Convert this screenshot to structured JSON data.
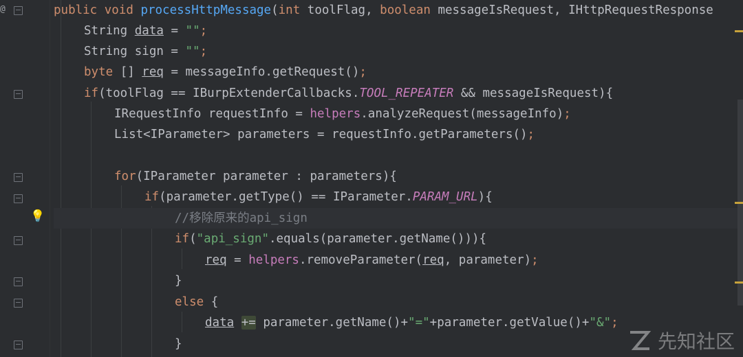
{
  "editor": {
    "lines": [
      {
        "id": "l1",
        "tokens": [
          {
            "t": "public void ",
            "c": "kw"
          },
          {
            "t": "processHttpMessage",
            "c": "fn"
          },
          {
            "t": "(",
            "c": ""
          },
          {
            "t": "int ",
            "c": "kw"
          },
          {
            "t": "toolFlag, ",
            "c": ""
          },
          {
            "t": "boolean ",
            "c": "kw"
          },
          {
            "t": "messageIsRequest, IHttpRequestResponse",
            "c": ""
          }
        ]
      },
      {
        "id": "l2",
        "tokens": [
          {
            "t": "String ",
            "c": ""
          },
          {
            "t": "data",
            "c": "under"
          },
          {
            "t": " = ",
            "c": ""
          },
          {
            "t": "\"\"",
            "c": "str"
          },
          {
            "t": ";",
            "c": "kw"
          }
        ]
      },
      {
        "id": "l3",
        "tokens": [
          {
            "t": "String sign = ",
            "c": ""
          },
          {
            "t": "\"\"",
            "c": "str"
          },
          {
            "t": ";",
            "c": "kw"
          }
        ]
      },
      {
        "id": "l4",
        "tokens": [
          {
            "t": "byte ",
            "c": "kw"
          },
          {
            "t": "[] ",
            "c": ""
          },
          {
            "t": "req",
            "c": "under"
          },
          {
            "t": " = messageInfo.getRequest()",
            "c": ""
          },
          {
            "t": ";",
            "c": "kw"
          }
        ]
      },
      {
        "id": "l5",
        "tokens": [
          {
            "t": "if",
            "c": "kw"
          },
          {
            "t": "(toolFlag == IBurpExtenderCallbacks.",
            "c": ""
          },
          {
            "t": "TOOL_REPEATER",
            "c": "const"
          },
          {
            "t": " && messageIsRequest){",
            "c": ""
          }
        ]
      },
      {
        "id": "l6",
        "tokens": [
          {
            "t": "IRequestInfo requestInfo = ",
            "c": ""
          },
          {
            "t": "helpers",
            "c": "field"
          },
          {
            "t": ".analyzeRequest(messageInfo)",
            "c": ""
          },
          {
            "t": ";",
            "c": "kw"
          }
        ]
      },
      {
        "id": "l7",
        "tokens": [
          {
            "t": "List<IParameter> parameters = requestInfo.getParameters()",
            "c": ""
          },
          {
            "t": ";",
            "c": "kw"
          }
        ]
      },
      {
        "id": "l8",
        "tokens": []
      },
      {
        "id": "l9",
        "tokens": [
          {
            "t": "for",
            "c": "kw"
          },
          {
            "t": "(IParameter parameter : parameters){",
            "c": ""
          }
        ]
      },
      {
        "id": "l10",
        "tokens": [
          {
            "t": "if",
            "c": "kw"
          },
          {
            "t": "(parameter.getType() == IParameter.",
            "c": ""
          },
          {
            "t": "PARAM_URL",
            "c": "const"
          },
          {
            "t": "){",
            "c": ""
          }
        ]
      },
      {
        "id": "l11",
        "tokens": [
          {
            "t": "//移除原来的api_sign",
            "c": "cm"
          }
        ]
      },
      {
        "id": "l12",
        "tokens": [
          {
            "t": "if",
            "c": "kw"
          },
          {
            "t": "(",
            "c": ""
          },
          {
            "t": "\"api_sign\"",
            "c": "str"
          },
          {
            "t": ".equals(parameter.getName())){",
            "c": ""
          }
        ]
      },
      {
        "id": "l13",
        "tokens": [
          {
            "t": "req",
            "c": "under"
          },
          {
            "t": " = ",
            "c": ""
          },
          {
            "t": "helpers",
            "c": "field"
          },
          {
            "t": ".removeParameter(",
            "c": ""
          },
          {
            "t": "req",
            "c": "under"
          },
          {
            "t": ", parameter)",
            "c": ""
          },
          {
            "t": ";",
            "c": "kw"
          }
        ]
      },
      {
        "id": "l14",
        "tokens": [
          {
            "t": "}",
            "c": ""
          }
        ]
      },
      {
        "id": "l15",
        "tokens": [
          {
            "t": "else ",
            "c": "kw"
          },
          {
            "t": "{",
            "c": ""
          }
        ]
      },
      {
        "id": "l16",
        "tokens": [
          {
            "t": "data",
            "c": "under"
          },
          {
            "t": " ",
            "c": ""
          },
          {
            "t": "+=",
            "c": "hl"
          },
          {
            "t": " parameter.getName()+",
            "c": ""
          },
          {
            "t": "\"=\"",
            "c": "str"
          },
          {
            "t": "+parameter.getValue()+",
            "c": ""
          },
          {
            "t": "\"&\"",
            "c": "str"
          },
          {
            "t": ";",
            "c": "kw"
          }
        ]
      },
      {
        "id": "l17",
        "tokens": [
          {
            "t": "}",
            "c": ""
          }
        ]
      }
    ]
  },
  "gutter": {
    "annotation_glyph": "@",
    "bulb_glyph": "💡"
  },
  "watermark": {
    "text": "先知社区"
  },
  "colors": {
    "background": "#2b2d30",
    "keyword": "#cf8e6d",
    "function": "#56a8f5",
    "string": "#6aab73",
    "comment": "#7a7e85",
    "constant": "#c77dbb"
  }
}
